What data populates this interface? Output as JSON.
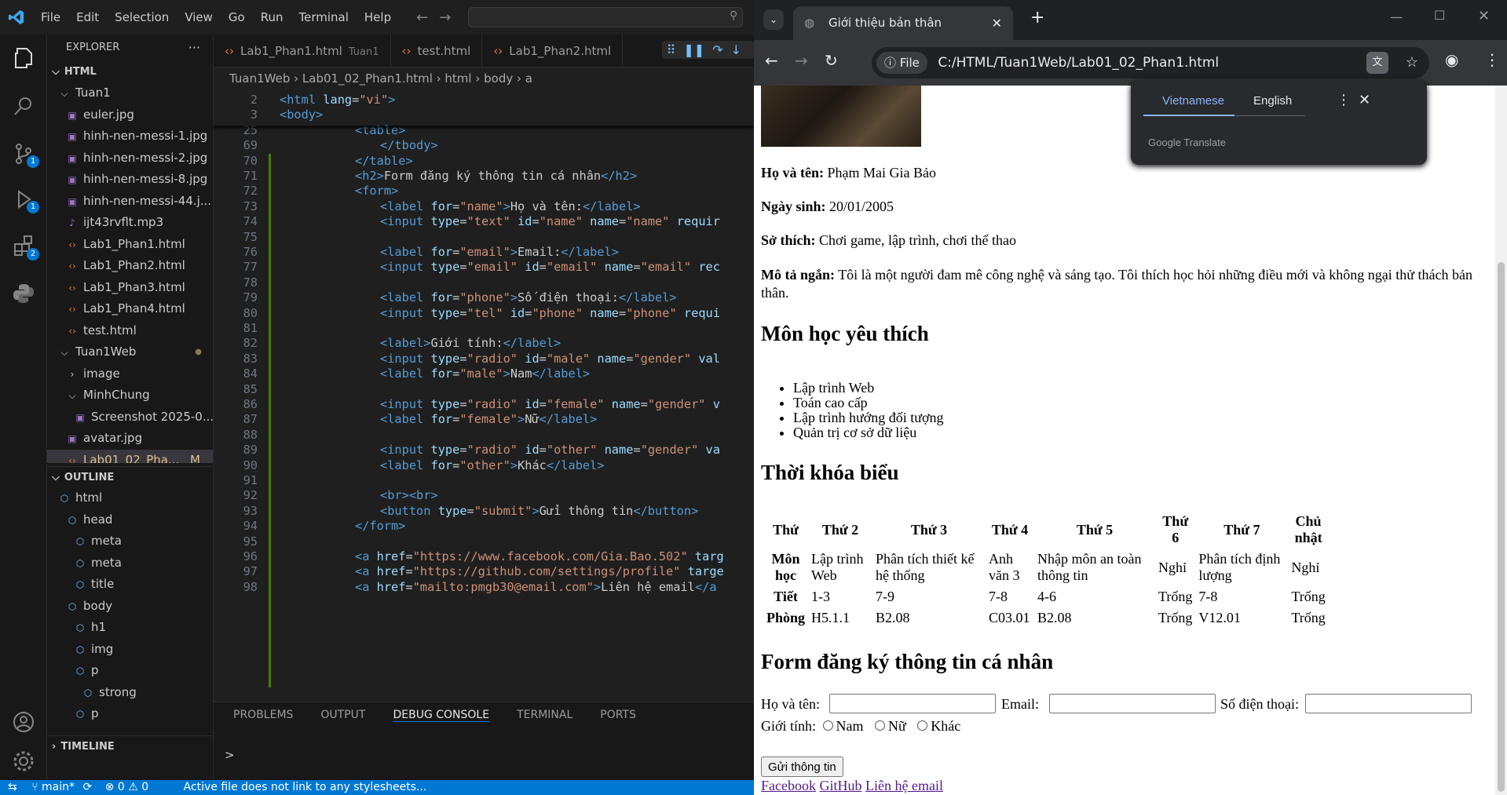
{
  "vscode": {
    "menu": [
      "File",
      "Edit",
      "Selection",
      "View",
      "Go",
      "Run",
      "Terminal",
      "Help"
    ],
    "activity_badges": {
      "scm": "1",
      "debug": "1",
      "ext": "2"
    },
    "explorer_title": "EXPLORER",
    "html_section": "HTML",
    "files": [
      {
        "name": "Tuan1",
        "kind": "folder",
        "indent": 1
      },
      {
        "name": "euler.jpg",
        "kind": "img",
        "indent": 2
      },
      {
        "name": "hinh-nen-messi-1.jpg",
        "kind": "img",
        "indent": 2
      },
      {
        "name": "hinh-nen-messi-2.jpg",
        "kind": "img",
        "indent": 2
      },
      {
        "name": "hinh-nen-messi-8.jpg",
        "kind": "img",
        "indent": 2
      },
      {
        "name": "hinh-nen-messi-44.j...",
        "kind": "img",
        "indent": 2
      },
      {
        "name": "ijt43rvflt.mp3",
        "kind": "audio",
        "indent": 2
      },
      {
        "name": "Lab1_Phan1.html",
        "kind": "html",
        "indent": 2
      },
      {
        "name": "Lab1_Phan2.html",
        "kind": "html",
        "indent": 2
      },
      {
        "name": "Lab1_Phan3.html",
        "kind": "html",
        "indent": 2
      },
      {
        "name": "Lab1_Phan4.html",
        "kind": "html",
        "indent": 2
      },
      {
        "name": "test.html",
        "kind": "html",
        "indent": 2
      },
      {
        "name": "Tuan1Web",
        "kind": "folder",
        "indent": 1
      },
      {
        "name": "image",
        "kind": "folder-closed",
        "indent": 2
      },
      {
        "name": "MinhChung",
        "kind": "folder",
        "indent": 2
      },
      {
        "name": "Screenshot 2025-0...",
        "kind": "img",
        "indent": 3
      },
      {
        "name": "avatar.jpg",
        "kind": "img",
        "indent": 2
      },
      {
        "name": "Lab01_02_Pha...",
        "kind": "html",
        "indent": 2,
        "badge": "M"
      }
    ],
    "outline_title": "OUTLINE",
    "outline": [
      {
        "name": "html",
        "indent": 1
      },
      {
        "name": "head",
        "indent": 2
      },
      {
        "name": "meta",
        "indent": 3
      },
      {
        "name": "meta",
        "indent": 3
      },
      {
        "name": "title",
        "indent": 3
      },
      {
        "name": "body",
        "indent": 2
      },
      {
        "name": "h1",
        "indent": 3
      },
      {
        "name": "img",
        "indent": 3
      },
      {
        "name": "p",
        "indent": 3
      },
      {
        "name": "strong",
        "indent": 4
      },
      {
        "name": "p",
        "indent": 3
      }
    ],
    "timeline_title": "TIMELINE",
    "tabs": [
      {
        "label": "Lab1_Phan1.html",
        "hint": "Tuan1"
      },
      {
        "label": "test.html",
        "hint": ""
      },
      {
        "label": "Lab1_Phan2.html",
        "hint": ""
      }
    ],
    "breadcrumb": [
      "Tuan1Web",
      "Lab01_02_Phan1.html",
      "html",
      "body",
      "a"
    ],
    "code_lines": [
      {
        "n": "2",
        "html": "<span class='t'>&lt;html</span> <span class='a'>lang</span>=<span class='s'>\"vi\"</span><span class='t'>&gt;</span>",
        "ind": 0
      },
      {
        "n": "3",
        "html": "<span class='t'>&lt;body&gt;</span>",
        "ind": 0
      },
      {
        "n": "25",
        "html": "<span class='t'>&lt;table&gt;</span>",
        "ind": 3
      },
      {
        "n": "69",
        "html": "<span class='t'>&lt;/tbody&gt;</span>",
        "ind": 4
      },
      {
        "n": "70",
        "html": "<span class='t'>&lt;/table&gt;</span>",
        "ind": 3
      },
      {
        "n": "71",
        "html": "<span class='t'>&lt;h2&gt;</span>Form đăng ký thông tin cá nhân<span class='t'>&lt;/h2&gt;</span>",
        "ind": 3
      },
      {
        "n": "72",
        "html": "<span class='t'>&lt;form&gt;</span>",
        "ind": 3
      },
      {
        "n": "73",
        "html": "<span class='t'>&lt;label</span> <span class='a'>for</span>=<span class='s'>\"name\"</span><span class='t'>&gt;</span>Họ và tên:<span class='t'>&lt;/label&gt;</span>",
        "ind": 4
      },
      {
        "n": "74",
        "html": "<span class='t'>&lt;input</span> <span class='a'>type</span>=<span class='s'>\"text\"</span> <span class='a'>id</span>=<span class='s'>\"name\"</span> <span class='a'>name</span>=<span class='s'>\"name\"</span> <span class='a'>requir</span>",
        "ind": 4
      },
      {
        "n": "75",
        "html": "",
        "ind": 4
      },
      {
        "n": "76",
        "html": "<span class='t'>&lt;label</span> <span class='a'>for</span>=<span class='s'>\"email\"</span><span class='t'>&gt;</span>Email:<span class='t'>&lt;/label&gt;</span>",
        "ind": 4
      },
      {
        "n": "77",
        "html": "<span class='t'>&lt;input</span> <span class='a'>type</span>=<span class='s'>\"email\"</span> <span class='a'>id</span>=<span class='s'>\"email\"</span> <span class='a'>name</span>=<span class='s'>\"email\"</span> <span class='a'>rec</span>",
        "ind": 4
      },
      {
        "n": "78",
        "html": "",
        "ind": 4
      },
      {
        "n": "79",
        "html": "<span class='t'>&lt;label</span> <span class='a'>for</span>=<span class='s'>\"phone\"</span><span class='t'>&gt;</span>Số điện thoại:<span class='t'>&lt;/label&gt;</span>",
        "ind": 4
      },
      {
        "n": "80",
        "html": "<span class='t'>&lt;input</span> <span class='a'>type</span>=<span class='s'>\"tel\"</span> <span class='a'>id</span>=<span class='s'>\"phone\"</span> <span class='a'>name</span>=<span class='s'>\"phone\"</span> <span class='a'>requi</span>",
        "ind": 4
      },
      {
        "n": "81",
        "html": "",
        "ind": 4
      },
      {
        "n": "82",
        "html": "<span class='t'>&lt;label&gt;</span>Giới tính:<span class='t'>&lt;/label&gt;</span>",
        "ind": 4
      },
      {
        "n": "83",
        "html": "<span class='t'>&lt;input</span> <span class='a'>type</span>=<span class='s'>\"radio\"</span> <span class='a'>id</span>=<span class='s'>\"male\"</span> <span class='a'>name</span>=<span class='s'>\"gender\"</span> <span class='a'>val</span>",
        "ind": 4
      },
      {
        "n": "84",
        "html": "<span class='t'>&lt;label</span> <span class='a'>for</span>=<span class='s'>\"male\"</span><span class='t'>&gt;</span>Nam<span class='t'>&lt;/label&gt;</span>",
        "ind": 4
      },
      {
        "n": "85",
        "html": "",
        "ind": 4
      },
      {
        "n": "86",
        "html": "<span class='t'>&lt;input</span> <span class='a'>type</span>=<span class='s'>\"radio\"</span> <span class='a'>id</span>=<span class='s'>\"female\"</span> <span class='a'>name</span>=<span class='s'>\"gender\"</span> <span class='a'>v</span>",
        "ind": 4
      },
      {
        "n": "87",
        "html": "<span class='t'>&lt;label</span> <span class='a'>for</span>=<span class='s'>\"female\"</span><span class='t'>&gt;</span>Nữ<span class='t'>&lt;/label&gt;</span>",
        "ind": 4
      },
      {
        "n": "88",
        "html": "",
        "ind": 4
      },
      {
        "n": "89",
        "html": "<span class='t'>&lt;input</span> <span class='a'>type</span>=<span class='s'>\"radio\"</span> <span class='a'>id</span>=<span class='s'>\"other\"</span> <span class='a'>name</span>=<span class='s'>\"gender\"</span> <span class='a'>va</span>",
        "ind": 4
      },
      {
        "n": "90",
        "html": "<span class='t'>&lt;label</span> <span class='a'>for</span>=<span class='s'>\"other\"</span><span class='t'>&gt;</span>Khác<span class='t'>&lt;/label&gt;</span>",
        "ind": 4
      },
      {
        "n": "91",
        "html": "",
        "ind": 4
      },
      {
        "n": "92",
        "html": "<span class='t'>&lt;br&gt;&lt;br&gt;</span>",
        "ind": 4
      },
      {
        "n": "93",
        "html": "<span class='t'>&lt;button</span> <span class='a'>type</span>=<span class='s'>\"submit\"</span><span class='t'>&gt;</span>Gửi thông tin<span class='t'>&lt;/button&gt;</span>",
        "ind": 4
      },
      {
        "n": "94",
        "html": "<span class='t'>&lt;/form&gt;</span>",
        "ind": 3
      },
      {
        "n": "95",
        "html": "",
        "ind": 3
      },
      {
        "n": "96",
        "html": "<span class='t'>&lt;a</span> <span class='a'>href</span>=<span class='s'>\"https://www.facebook.com/Gia.Bao.502\"</span> <span class='a'>targ</span>",
        "ind": 3
      },
      {
        "n": "97",
        "html": "<span class='t'>&lt;a</span> <span class='a'>href</span>=<span class='s'>\"https://github.com/settings/profile\"</span> <span class='a'>targe</span>",
        "ind": 3
      },
      {
        "n": "98",
        "html": "<span class='t'>&lt;a</span> <span class='a'>href</span>=<span class='s'>\"mailto:pmgb30@email.com\"</span><span class='t'>&gt;</span>Liên hệ email<span class='t'>&lt;/a</span>",
        "ind": 3
      }
    ],
    "panel_tabs": [
      "PROBLEMS",
      "OUTPUT",
      "DEBUG CONSOLE",
      "TERMINAL",
      "PORTS"
    ],
    "panel_prompt": ">",
    "status": {
      "branch": "main*",
      "errors": "0",
      "warnings": "0",
      "message": "Active file does not link to any stylesheets..."
    }
  },
  "chrome": {
    "tab_title": "Giới thiệu bản thân",
    "url_chip": "File",
    "url": "C:/HTML/Tuan1Web/Lab01_02_Phan1.html",
    "translate": {
      "lang1": "Vietnamese",
      "lang2": "English",
      "brand": "Google Translate"
    }
  },
  "page": {
    "name_label": "Họ và tên:",
    "name_value": "Phạm Mai Gia Bảo",
    "dob_label": "Ngày sinh:",
    "dob_value": "20/01/2005",
    "hobby_label": "Sở thích:",
    "hobby_value": "Chơi game, lập trình, chơi thể thao",
    "desc_label": "Mô tả ngắn:",
    "desc_value": "Tôi là một người đam mê công nghệ và sáng tạo. Tôi thích học hỏi những điều mới và không ngại thử thách bản thân.",
    "subjects_title": "Môn học yêu thích",
    "subjects": [
      "Lập trình Web",
      "Toán cao cấp",
      "Lập trình hướng đối tượng",
      "Quản trị cơ sở dữ liệu"
    ],
    "schedule_title": "Thời khóa biểu",
    "schedule_head": [
      "Thứ",
      "Thứ 2",
      "Thứ 3",
      "Thứ 4",
      "Thứ 5",
      "Thứ 6",
      "Thứ 7",
      "Chủ nhật"
    ],
    "schedule_rows": [
      [
        "Môn học",
        "Lập trình Web",
        "Phân tích thiết kế hệ thống",
        "Anh văn 3",
        "Nhập môn an toàn thông tin",
        "Nghỉ",
        "Phân tích định lượng",
        "Nghỉ"
      ],
      [
        "Tiết",
        "1-3",
        "7-9",
        "7-8",
        "4-6",
        "Trống",
        "7-8",
        "Trống"
      ],
      [
        "Phòng",
        "H5.1.1",
        "B2.08",
        "C03.01",
        "B2.08",
        "Trống",
        "V12.01",
        "Trống"
      ]
    ],
    "form_title": "Form đăng ký thông tin cá nhân",
    "form_name": "Họ và tên:",
    "form_email": "Email:",
    "form_phone": "Số điện thoại:",
    "form_gender": "Giới tính:",
    "g_male": "Nam",
    "g_female": "Nữ",
    "g_other": "Khác",
    "submit": "Gửi thông tin",
    "links": [
      "Facebook",
      "GitHub",
      "Liên hệ email"
    ]
  }
}
